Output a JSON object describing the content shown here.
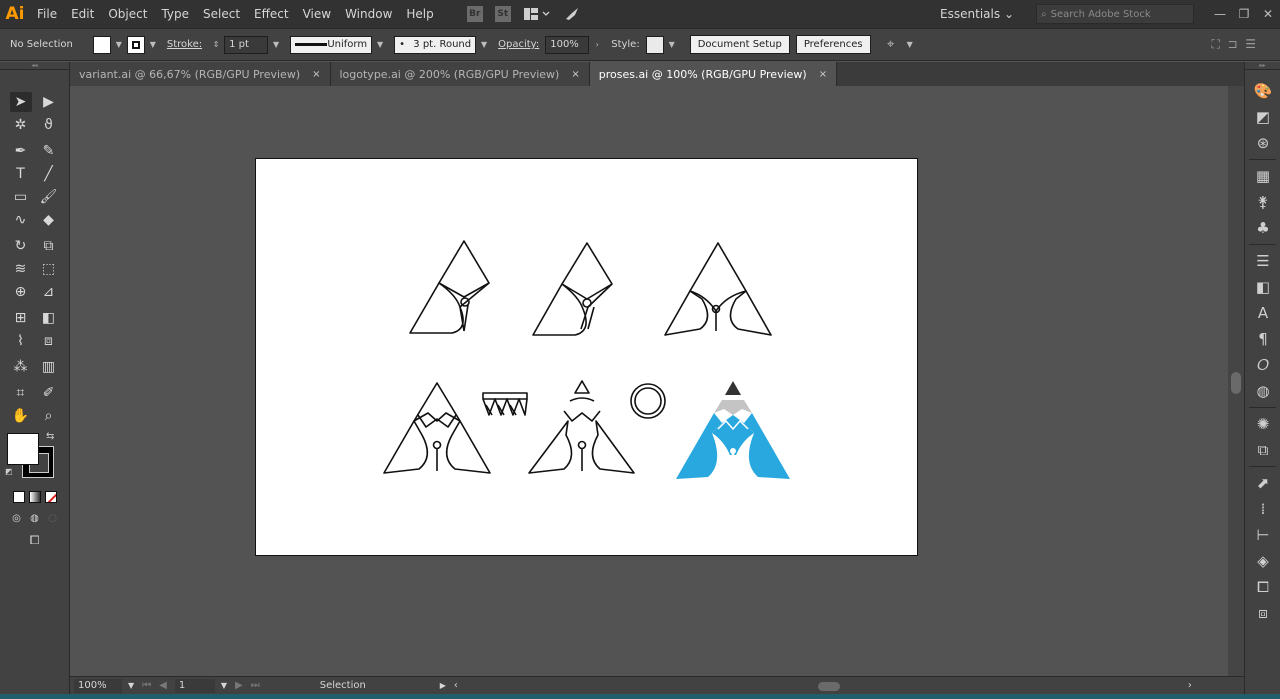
{
  "app": {
    "logo": "Ai"
  },
  "menu": [
    "File",
    "Edit",
    "Object",
    "Type",
    "Select",
    "Effect",
    "View",
    "Window",
    "Help"
  ],
  "menu_icons": {
    "br": "Br",
    "st": "St"
  },
  "workspace": "Essentials",
  "search": {
    "placeholder": "Search Adobe Stock"
  },
  "control": {
    "selection": "No Selection",
    "stroke_label": "Stroke:",
    "stroke_value": "1 pt",
    "profile": "Uniform",
    "brush": "3 pt. Round",
    "opacity_label": "Opacity:",
    "opacity_value": "100%",
    "style_label": "Style:",
    "document_setup": "Document Setup",
    "preferences": "Preferences"
  },
  "tabs": [
    {
      "label": "variant.ai @ 66,67% (RGB/GPU Preview)",
      "close": "×"
    },
    {
      "label": "logotype.ai @ 200% (RGB/GPU Preview)",
      "close": "×"
    },
    {
      "label": "proses.ai @ 100% (RGB/GPU Preview)",
      "close": "×"
    }
  ],
  "status": {
    "zoom": "100%",
    "artboard": "1",
    "tool": "Selection"
  },
  "colors": {
    "accent_blue": "#29a8e0",
    "logo_orange": "#ff9a00"
  }
}
